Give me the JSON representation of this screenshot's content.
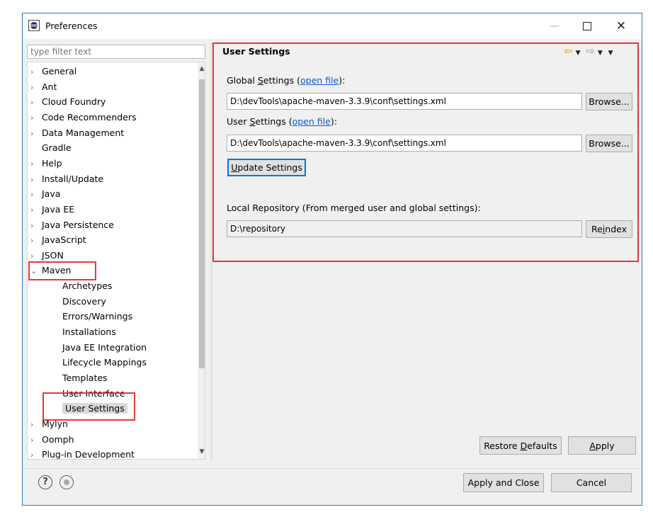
{
  "window": {
    "title": "Preferences",
    "minimize_glyph": "—",
    "close_glyph": "✕"
  },
  "filter": {
    "placeholder": "type filter text"
  },
  "tree": {
    "items": [
      {
        "label": "General",
        "expandable": true
      },
      {
        "label": "Ant",
        "expandable": true
      },
      {
        "label": "Cloud Foundry",
        "expandable": true
      },
      {
        "label": "Code Recommenders",
        "expandable": true
      },
      {
        "label": "Data Management",
        "expandable": true
      },
      {
        "label": "Gradle",
        "expandable": false
      },
      {
        "label": "Help",
        "expandable": true
      },
      {
        "label": "Install/Update",
        "expandable": true
      },
      {
        "label": "Java",
        "expandable": true
      },
      {
        "label": "Java EE",
        "expandable": true
      },
      {
        "label": "Java Persistence",
        "expandable": true
      },
      {
        "label": "JavaScript",
        "expandable": true
      },
      {
        "label": "JSON",
        "expandable": true
      },
      {
        "label": "Maven",
        "expandable": true,
        "expanded": true
      },
      {
        "label": "Archetypes",
        "child": true
      },
      {
        "label": "Discovery",
        "child": true
      },
      {
        "label": "Errors/Warnings",
        "child": true
      },
      {
        "label": "Installations",
        "child": true
      },
      {
        "label": "Java EE Integration",
        "child": true
      },
      {
        "label": "Lifecycle Mappings",
        "child": true
      },
      {
        "label": "Templates",
        "child": true
      },
      {
        "label": "User Interface",
        "child": true
      },
      {
        "label": "User Settings",
        "child": true,
        "selected": true
      },
      {
        "label": "Mylyn",
        "expandable": true
      },
      {
        "label": "Oomph",
        "expandable": true
      },
      {
        "label": "Plug-in Development",
        "expandable": true
      }
    ]
  },
  "pane": {
    "title": "User Settings",
    "global_label_pre": "Global ",
    "global_label_mnemonic": "S",
    "global_label_post": "ettings (",
    "open_file": "open file",
    "label_close": "):",
    "global_path": "D:\\devTools\\apache-maven-3.3.9\\conf\\settings.xml",
    "user_label_pre": "User ",
    "user_label_mnemonic": "S",
    "user_label_post": "ettings (",
    "user_path": "D:\\devTools\\apache-maven-3.3.9\\conf\\settings.xml",
    "browse": "Browse...",
    "update_pre": "",
    "update_mnemonic": "U",
    "update_post": "pdate Settings",
    "local_repo_label": "Local Repository (From merged user and global settings):",
    "local_repo_path": "D:\\repository",
    "reindex_pre": "Re",
    "reindex_mnemonic": "i",
    "reindex_post": "ndex",
    "restore_pre": "Restore ",
    "restore_mnemonic": "D",
    "restore_post": "efaults",
    "apply_mnemonic": "A",
    "apply_post": "pply"
  },
  "footer": {
    "apply_close": "Apply and Close",
    "cancel": "Cancel",
    "help_glyph": "?"
  },
  "colors": {
    "highlight": "#e53935",
    "link": "#0a5bd5",
    "border": "#2b79c2"
  }
}
